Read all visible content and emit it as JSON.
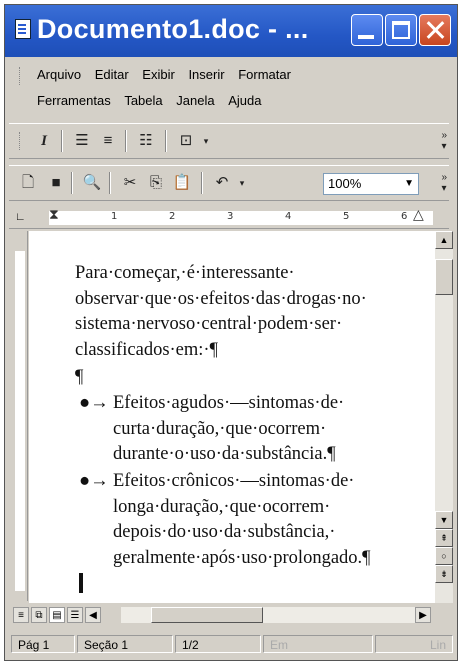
{
  "window": {
    "title": "Documento1.doc - ..."
  },
  "menu": {
    "row1": [
      "Arquivo",
      "Editar",
      "Exibir",
      "Inserir",
      "Formatar"
    ],
    "row2": [
      "Ferramentas",
      "Tabela",
      "Janela",
      "Ajuda"
    ]
  },
  "toolbar": {
    "zoom": "100%"
  },
  "ruler": {
    "marks": [
      "1",
      "2",
      "3",
      "4",
      "5",
      "6"
    ]
  },
  "document": {
    "paragraph1": "Para·começar,·é·interessante· observar·que·os·efeitos·das·drogas·no· sistema·nervoso·central·podem·ser· classificados·em:·¶",
    "empty_paragraph": "¶",
    "bullets": [
      {
        "mark": "●→",
        "text": "Efeitos·agudos·—sintomas·de· curta·duração,·que·ocorrem· durante·o·uso·da·substância.¶"
      },
      {
        "mark": "●→",
        "text": "Efeitos·crônicos·—sintomas·de· longa·duração,·que·ocorrem· depois·do·uso·da·substância,· geralmente·após·uso·prolongado.¶"
      }
    ]
  },
  "statusbar": {
    "page": "Pág 1",
    "section": "Seção 1",
    "pages": "1/2",
    "ext1": "Em",
    "ext2": "Lin"
  }
}
